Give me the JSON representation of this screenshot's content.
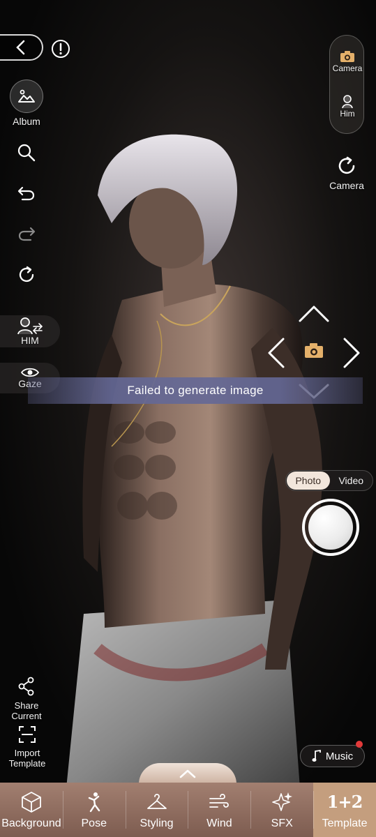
{
  "left_toolbar": {
    "album_label": "Album",
    "him_label": "HIM",
    "gaze_label": "Gaze",
    "share_label": "Share\nCurrent",
    "import_label": "Import\nTemplate"
  },
  "right_toolbar": {
    "camera_label": "Camera",
    "him_label": "Him",
    "camera_rotate_label": "Camera"
  },
  "toast": {
    "message": "Failed to generate image"
  },
  "capture": {
    "mode_options": [
      "Photo",
      "Video"
    ],
    "selected_mode": "Photo"
  },
  "music": {
    "label": "Music"
  },
  "bottom_nav": {
    "items": [
      {
        "label": "Background",
        "icon": "cube-icon"
      },
      {
        "label": "Pose",
        "icon": "pose-figure-icon"
      },
      {
        "label": "Styling",
        "icon": "hanger-icon"
      },
      {
        "label": "Wind",
        "icon": "wind-icon"
      },
      {
        "label": "SFX",
        "icon": "sparkle-icon"
      },
      {
        "label": "Template",
        "icon": "template-1-plus-2-icon"
      }
    ],
    "selected": "Template",
    "template_glyph": "1+2"
  },
  "colors": {
    "nav_background": "#8f6e61",
    "nav_selected": "#c49e7e",
    "toast_background": "#6c6f9e",
    "accent_gold": "#e4b06a",
    "notification_dot": "#e23a3a"
  }
}
